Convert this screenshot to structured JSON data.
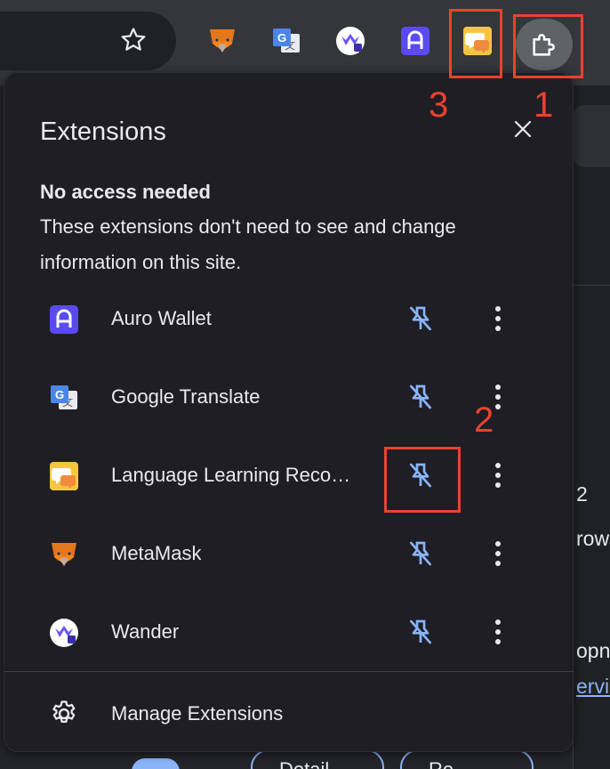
{
  "colors": {
    "accent": "#8ab4f8",
    "annotation": "#e8432e",
    "popup_bg": "#1f1e24",
    "text": "#e8eaed"
  },
  "toolbar": {
    "bookmark_icon": "star-icon",
    "pinned_extensions": [
      "metamask-fox-icon",
      "google-translate-icon",
      "wander-icon",
      "auro-wallet-icon",
      "language-learning-icon"
    ],
    "extensions_icon": "puzzle-icon"
  },
  "popup": {
    "title": "Extensions",
    "close_icon": "close-icon",
    "section": {
      "title": "No access needed",
      "description": "These extensions don't need to see and change information on this site."
    },
    "extensions": [
      {
        "name": "Auro Wallet",
        "icon": "auro-wallet-icon",
        "pinned": false
      },
      {
        "name": "Google Translate",
        "icon": "google-translate-icon",
        "pinned": false
      },
      {
        "name": "Language Learning Reco…",
        "icon": "language-learning-icon",
        "pinned": false
      },
      {
        "name": "MetaMask",
        "icon": "metamask-fox-icon",
        "pinned": false
      },
      {
        "name": "Wander",
        "icon": "wander-icon",
        "pinned": false
      }
    ],
    "manage_label": "Manage Extensions",
    "manage_icon": "gear-icon"
  },
  "annotations": {
    "label_1": "1",
    "label_2": "2",
    "label_3": "3"
  },
  "background_page": {
    "fragment_num": "2",
    "fragment_rows": "rows",
    "fragment_opnl": "opnl",
    "fragment_servic": "ervic",
    "btn_left": "Detail",
    "btn_right": "Re"
  }
}
